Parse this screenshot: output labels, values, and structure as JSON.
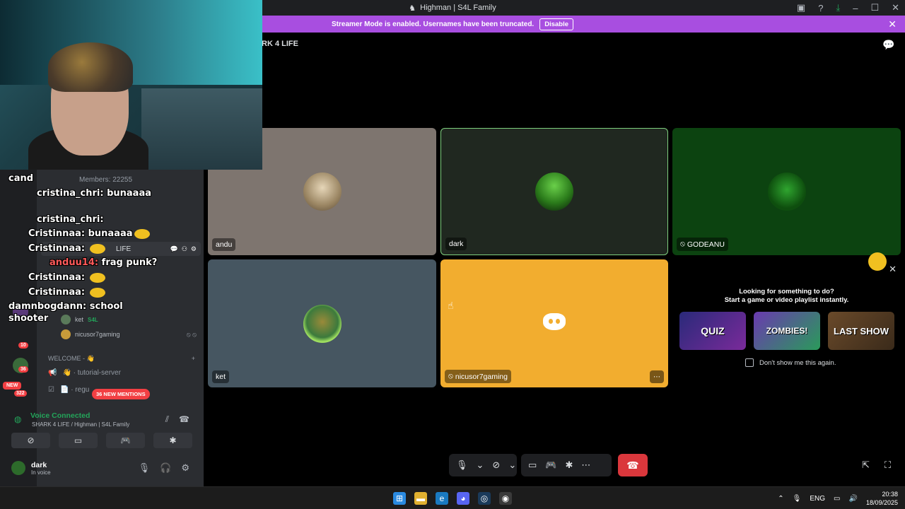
{
  "window": {
    "title": "Highman | S4L Family"
  },
  "streamer_bar": {
    "message": "Streamer Mode is enabled. Usernames have been truncated.",
    "disable_label": "Disable"
  },
  "stage": {
    "channel_title": "RK 4 LIFE"
  },
  "sidebar": {
    "members_label": "Members: 22255",
    "server_row_label": "LIFE",
    "voice_users": [
      {
        "name": "ket",
        "tag": "S4L"
      },
      {
        "name": "nicusor7gaming"
      }
    ],
    "category": "WELCOME - 👋",
    "channels": [
      {
        "name": "👋 · tutorial-server"
      },
      {
        "name": "📄 · regu"
      }
    ],
    "new_badge": "NEW",
    "mentions_badge": "36 NEW MENTIONS",
    "guild_badges": [
      "10",
      "36",
      "322"
    ]
  },
  "voice": {
    "status": "Voice Connected",
    "location": "SHARK 4 LIFE / Highman | S4L Family"
  },
  "user": {
    "name": "dark",
    "status": "In voice"
  },
  "chat_overlay": [
    {
      "user": "",
      "text": "cand"
    },
    {
      "user": "cristina_chri:",
      "text": "bunaaaa"
    },
    {
      "user": "cristina_chri:",
      "text": ""
    },
    {
      "user": "Cristinnaa:",
      "text": "bunaaaa"
    },
    {
      "user": "Cristinnaa:",
      "text": ""
    },
    {
      "user": "anduu14:",
      "text": "frag punk?"
    },
    {
      "user": "Cristinnaa:",
      "text": ""
    },
    {
      "user": "Cristinnaa:",
      "text": ""
    },
    {
      "user": "damnbogdann:",
      "text": "school"
    },
    {
      "user": "",
      "text": "shooter"
    }
  ],
  "tiles": [
    {
      "name": "andu"
    },
    {
      "name": "dark"
    },
    {
      "name": "GODEANU"
    },
    {
      "name": "ket"
    },
    {
      "name": "nicusor7gaming"
    }
  ],
  "activity": {
    "line1": "Looking for something to do?",
    "line2": "Start a game or video playlist instantly.",
    "games": [
      "QUIZ",
      "ZOMBIES!",
      "LAST SHOW"
    ],
    "dont_show": "Don't show me this again."
  },
  "taskbar": {
    "lang": "ENG",
    "time": "20:38",
    "date": "18/09/2025"
  },
  "icons": {
    "accent": "#a84ee0",
    "voice_green": "#23a55a",
    "hangup_red": "#da373c"
  }
}
